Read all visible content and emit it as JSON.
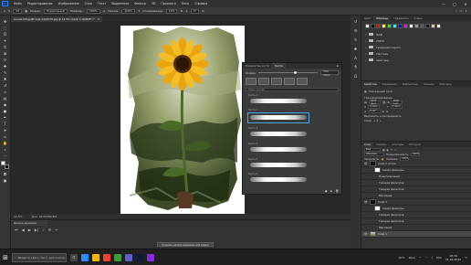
{
  "app": {
    "logo_text": "Ps"
  },
  "menu": [
    "Файл",
    "Редактирование",
    "Изображение",
    "Слои",
    "Текст",
    "Выделение",
    "Фильтр",
    "3D",
    "Просмотр",
    "Окно",
    "Справка"
  ],
  "window_controls": {
    "minimize": "—",
    "maximize": "□",
    "close": "✕"
  },
  "options_bar": {
    "brush_size": "50",
    "mode_label": "Режим:",
    "mode_value": "Нормальный",
    "opacity_label": "Непрозр.:",
    "opacity_value": "100%",
    "flow_label": "Нажим:",
    "flow_value": "100%",
    "smooth_label": "Сглаживание:",
    "smooth_value": "10%",
    "angle_value": "0°"
  },
  "document": {
    "tab_title": "sunset-fotografirovat-1424070.jpg @ 12,5% (Слой 1, RGB/8*) *",
    "close_label": "✕"
  },
  "status": {
    "zoom": "12,5%",
    "doc_info": "Док: 16,0M/89,8M"
  },
  "timeline": {
    "tab_label": "Шкала времени",
    "create_button": "Создать шкалу времени для видео"
  },
  "brush_panel": {
    "tabs": [
      "Параметры кисти",
      "Кисти"
    ],
    "size_label": "Размер:",
    "size_value": "300 пикс.",
    "search_placeholder": "Поиск кистей",
    "brush_labels": [
      "Кисть 1",
      "Кисть 2",
      "Кисть 3",
      "Кисть 4",
      "Кисть 5",
      "Кисть 6"
    ]
  },
  "swatches_panel": {
    "tabs": [
      "Цвет",
      "Образцы",
      "Градиенты",
      "Узоры"
    ],
    "colors": [
      "#ffffff",
      "#000000",
      "#ff0000",
      "#ffff00",
      "#00ff00",
      "#00ffff",
      "#0000ff",
      "#ff00ff",
      "#ffffff",
      "#9a9a9a",
      "#5a5a5a",
      "#1a1a1a",
      "#f2c5a0",
      "#ffffff"
    ],
    "folders": [
      "RGB",
      "CMYK",
      "Градации серого",
      "Пастель",
      "Светлые"
    ]
  },
  "properties_panel": {
    "tabs": [
      "Свойства",
      "Коррекция",
      "Библиотеки",
      "Каналы",
      "Контуры"
    ],
    "layer_type": "Пиксельный слой",
    "transform_label": "Трансформирование",
    "w_label": "Ш",
    "w_value": "5472 пикс.",
    "h_label": "В",
    "h_value": "3648 пикс.",
    "x_label": "X",
    "x_value": "0 пикс.",
    "y_label": "Y",
    "y_value": "0 пикс.",
    "angle_value": "0,00°",
    "align_label": "Выровнять и распределить",
    "layer_label": "Слой:"
  },
  "layers_panel": {
    "tabs": [
      "Слои",
      "Каналы",
      "Контуры",
      "История"
    ],
    "kind_label": "Вид",
    "blend_mode": "Обычные",
    "opacity_label": "Непрозрачность:",
    "opacity_value": "100%",
    "lock_label": "Закрепить:",
    "fill_label": "Заливка:",
    "fill_value": "100%",
    "layers": [
      {
        "name": "Слой 2 копия",
        "thumb": "black",
        "indent": 0
      },
      {
        "name": "Смарт-фильтры",
        "thumb": "white",
        "indent": 1
      },
      {
        "name": "Пуантилизация",
        "thumb": "none",
        "indent": 2
      },
      {
        "name": "Галерея фильтров",
        "thumb": "none",
        "indent": 2
      },
      {
        "name": "Галерея фильтров",
        "thumb": "none",
        "indent": 2
      },
      {
        "name": "Масляная",
        "thumb": "none",
        "indent": 2
      },
      {
        "name": "Слой 2",
        "thumb": "black",
        "indent": 0
      },
      {
        "name": "Смарт-фильтры",
        "thumb": "white",
        "indent": 1
      },
      {
        "name": "Галерея фильтров",
        "thumb": "none",
        "indent": 2
      },
      {
        "name": "Галерея фильтров",
        "thumb": "none",
        "indent": 2
      },
      {
        "name": "Масляная",
        "thumb": "none",
        "indent": 2
      },
      {
        "name": "Слой 1",
        "thumb": "img",
        "indent": 0
      }
    ]
  },
  "taskbar": {
    "search_placeholder": "Введите здесь текст для поиска",
    "tray_temp": "10°C",
    "tray_weather": "Ясно",
    "tray_lang": "РУС",
    "time": "18:34",
    "date": "21.04.2022",
    "app_colors": [
      "#2d8cff",
      "#f6b400",
      "#e8442e",
      "#3a9d3a",
      "#5b5fc7",
      "#0b1f3a",
      "#8a2be2"
    ]
  }
}
